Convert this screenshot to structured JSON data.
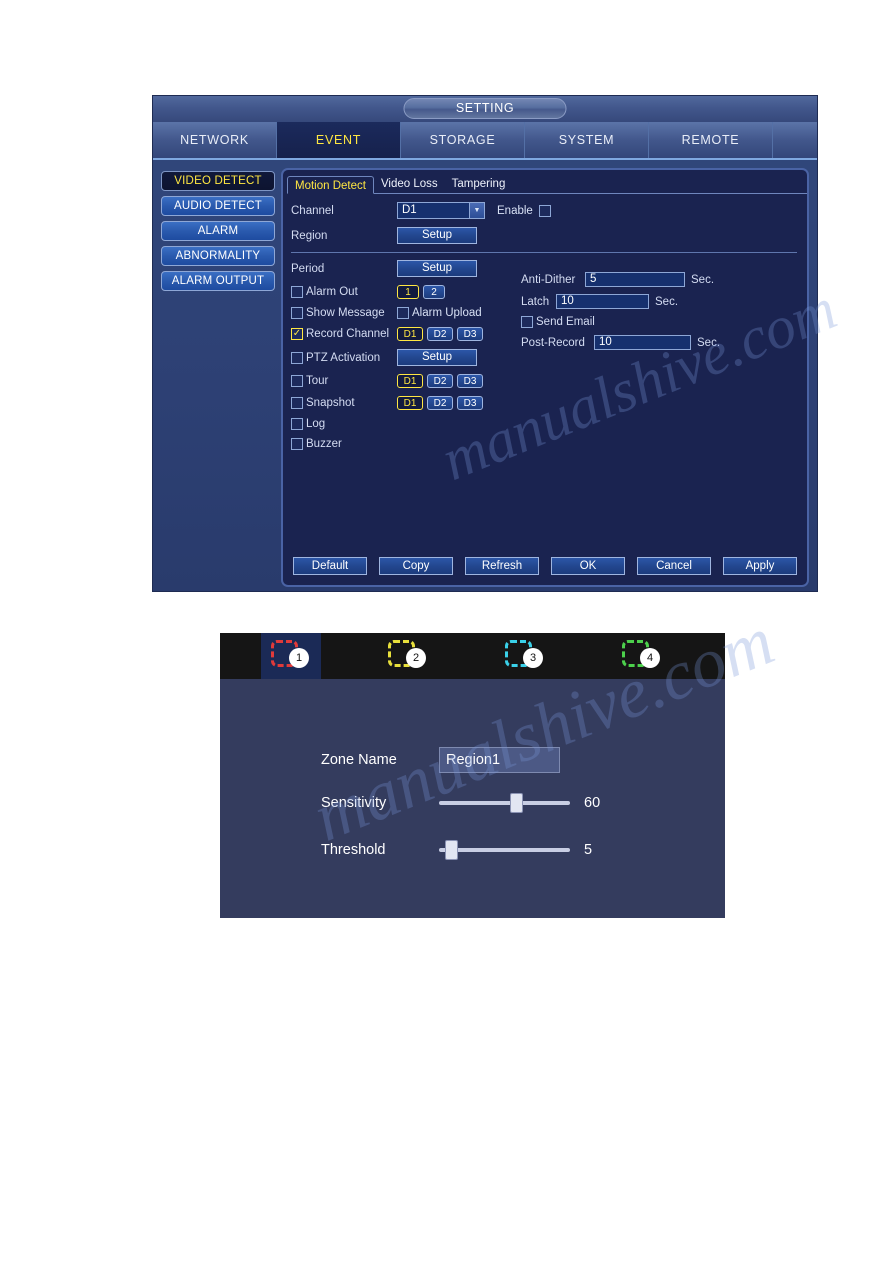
{
  "watermark": {
    "text": "manualshive.com"
  },
  "setting_window": {
    "title": "SETTING",
    "tabs": [
      {
        "label": "NETWORK",
        "active": false
      },
      {
        "label": "EVENT",
        "active": true
      },
      {
        "label": "STORAGE",
        "active": false
      },
      {
        "label": "SYSTEM",
        "active": false
      },
      {
        "label": "REMOTE",
        "active": false
      }
    ],
    "sidebar": {
      "items": [
        {
          "label": "VIDEO DETECT",
          "active": true
        },
        {
          "label": "AUDIO DETECT",
          "active": false
        },
        {
          "label": "ALARM",
          "active": false
        },
        {
          "label": "ABNORMALITY",
          "active": false
        },
        {
          "label": "ALARM OUTPUT",
          "active": false
        }
      ]
    },
    "sub_tabs": [
      {
        "label": "Motion Detect",
        "active": true
      },
      {
        "label": "Video Loss",
        "active": false
      },
      {
        "label": "Tampering",
        "active": false
      }
    ],
    "form": {
      "channel_label": "Channel",
      "channel_value": "D1",
      "enable_label": "Enable",
      "enable_checked": false,
      "region_label": "Region",
      "region_setup": "Setup",
      "period_label": "Period",
      "period_setup": "Setup",
      "alarm_out_label": "Alarm Out",
      "alarm_out_checked": false,
      "alarm_out_channels": [
        {
          "label": "1",
          "selected": true
        },
        {
          "label": "2",
          "selected": false
        }
      ],
      "show_message_label": "Show Message",
      "show_message_checked": false,
      "alarm_upload_label": "Alarm Upload",
      "alarm_upload_checked": false,
      "record_channel_label": "Record Channel",
      "record_channel_checked": true,
      "record_channels": [
        {
          "label": "D1",
          "selected": true
        },
        {
          "label": "D2",
          "selected": false
        },
        {
          "label": "D3",
          "selected": false
        }
      ],
      "ptz_label": "PTZ Activation",
      "ptz_checked": false,
      "ptz_setup": "Setup",
      "tour_label": "Tour",
      "tour_checked": false,
      "tour_channels": [
        {
          "label": "D1",
          "selected": true
        },
        {
          "label": "D2",
          "selected": false
        },
        {
          "label": "D3",
          "selected": false
        }
      ],
      "snapshot_label": "Snapshot",
      "snapshot_checked": false,
      "snapshot_channels": [
        {
          "label": "D1",
          "selected": true
        },
        {
          "label": "D2",
          "selected": false
        },
        {
          "label": "D3",
          "selected": false
        }
      ],
      "log_label": "Log",
      "log_checked": false,
      "buzzer_label": "Buzzer",
      "buzzer_checked": false,
      "anti_dither_label": "Anti-Dither",
      "anti_dither_value": "5",
      "anti_dither_unit": "Sec.",
      "latch_label": "Latch",
      "latch_value": "10",
      "latch_unit": "Sec.",
      "send_email_label": "Send Email",
      "send_email_checked": false,
      "post_record_label": "Post-Record",
      "post_record_value": "10",
      "post_record_unit": "Sec."
    },
    "buttons": [
      {
        "label": "Default"
      },
      {
        "label": "Copy"
      },
      {
        "label": "Refresh"
      },
      {
        "label": "OK"
      },
      {
        "label": "Cancel"
      },
      {
        "label": "Apply"
      }
    ]
  },
  "zone_panel": {
    "zones": [
      {
        "number": "1",
        "color": "#e03a3a",
        "selected": true
      },
      {
        "number": "2",
        "color": "#e8e03c",
        "selected": false
      },
      {
        "number": "3",
        "color": "#3ad0e8",
        "selected": false
      },
      {
        "number": "4",
        "color": "#4cd04c",
        "selected": false
      }
    ],
    "zone_name_label": "Zone Name",
    "zone_name_value": "Region1",
    "sensitivity_label": "Sensitivity",
    "sensitivity_value": "60",
    "sensitivity_percent": 60,
    "threshold_label": "Threshold",
    "threshold_value": "5",
    "threshold_percent": 5
  }
}
